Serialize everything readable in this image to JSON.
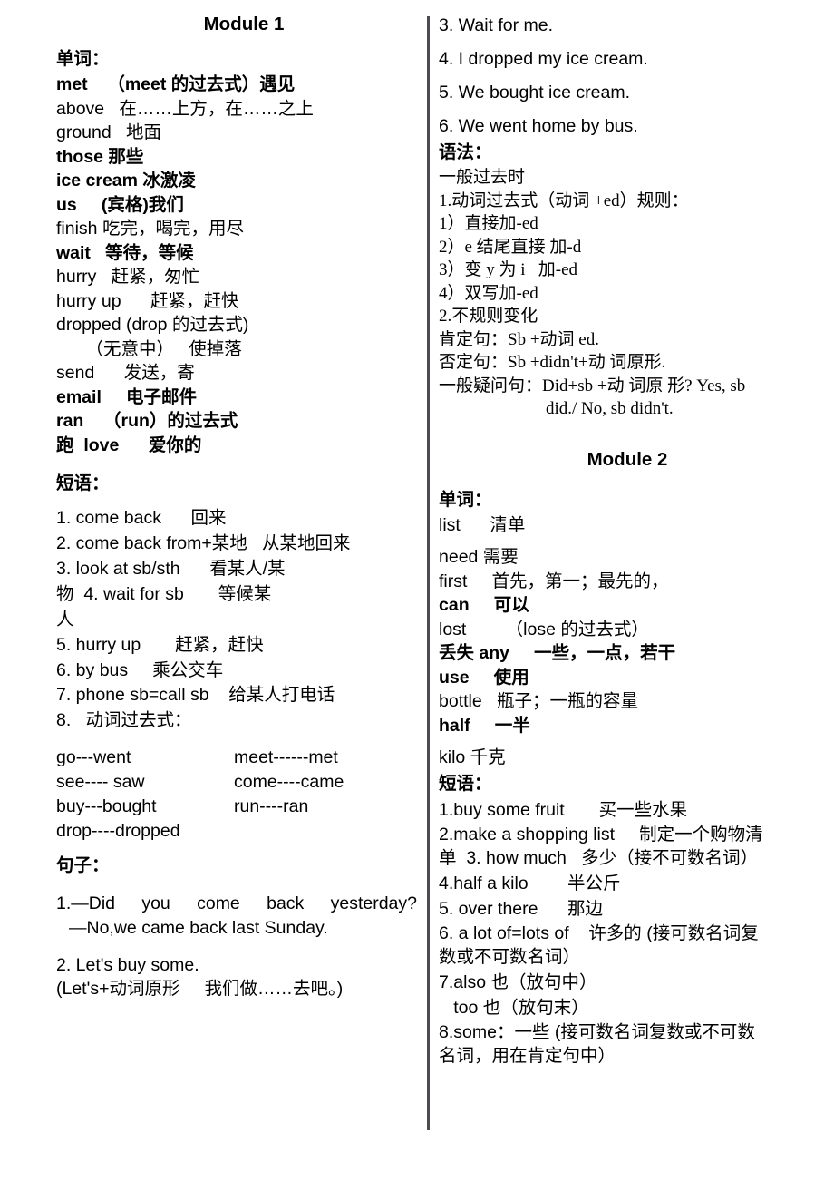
{
  "document": {
    "title": "Module 1 & Module 2 English study notes"
  },
  "left_column": {
    "module_title": "Module 1",
    "words_heading": "单词：",
    "words": [
      {
        "text": "met    （meet 的过去式）遇见",
        "bold": true
      },
      {
        "text": "above   在……上方，在……之上",
        "bold": false
      },
      {
        "text": "ground   地面",
        "bold": false
      },
      {
        "text": "those 那些",
        "bold": true
      },
      {
        "text": "ice cream 冰激凌",
        "bold": true
      },
      {
        "text": "us     (宾格)我们",
        "bold": true
      },
      {
        "text": "finish 吃完，喝完，用尽",
        "bold": false
      },
      {
        "text": "wait   等待，等候",
        "bold": true
      },
      {
        "text": "hurry   赶紧，匆忙",
        "bold": false
      },
      {
        "text": "hurry up      赶紧，赶快",
        "bold": false
      },
      {
        "text": "dropped (drop 的过去式)",
        "bold": false
      },
      {
        "text": "      （无意中）   使掉落",
        "bold": false
      },
      {
        "text": "send      发送，寄",
        "bold": false
      },
      {
        "text": "email     电子邮件",
        "bold": true
      },
      {
        "text": "ran    （run）的过去式",
        "bold": true
      },
      {
        "text": "跑  love      爱你的",
        "bold": true
      }
    ],
    "phrases_heading": "短语：",
    "phrases": [
      "1. come back      回来",
      "2. come back from+某地   从某地回来",
      "3. look at sb/sth      看某人/某",
      "物  4. wait for sb       等候某",
      "人",
      "5. hurry up       赶紧，赶快",
      "6. by bus     乘公交车",
      "7. phone sb=call sb    给某人打电话",
      "8.   动词过去式："
    ],
    "verb_pairs": [
      {
        "left": "go---went",
        "right": "meet------met"
      },
      {
        "left": "see---- saw",
        "right": "come----came"
      },
      {
        "left": "buy---bought",
        "right": "run----ran"
      },
      {
        "left": "drop----dropped",
        "right": ""
      }
    ],
    "sentences_heading": "句子：",
    "sentences": [
      "1.—Did you come back yesterday?",
      "—No,we came back last Sunday.",
      "2. Let's buy some.",
      "(Let's+动词原形     我们做……去吧。)"
    ]
  },
  "right_column": {
    "sentences_continued": [
      "3. Wait for me.",
      "4. I dropped my ice cream.",
      "5. We bought ice cream.",
      "6. We went home by bus."
    ],
    "grammar_heading": "语法：",
    "grammar_lines": [
      "一般过去时",
      "1.动词过去式（动词 +ed）规则：",
      "1）直接加-ed",
      "2）e 结尾直接 加-d",
      "3）变 y 为 i   加-ed",
      "4）双写加-ed",
      "2.不规则变化",
      "肯定句：Sb +动词 ed.",
      "否定句：Sb +didn't+动 词原形.",
      "一般疑问句：Did+sb +动 词原 形? Yes, sb"
    ],
    "grammar_last_line": "did./ No, sb didn't.",
    "module_title": "Module 2",
    "words_heading": "单词：",
    "words": [
      {
        "text": "list      清单",
        "bold": false
      },
      {
        "text": "",
        "bold": false
      },
      {
        "text": "need 需要",
        "bold": false
      },
      {
        "text": "first     首先，第一；最先的，",
        "bold": false
      },
      {
        "text": "can     可以",
        "bold": true
      },
      {
        "text": "lost        （lose 的过去式）",
        "bold": false
      },
      {
        "text": "丢失 any     一些，一点，若干",
        "bold": true
      },
      {
        "text": "use     使用",
        "bold": true
      },
      {
        "text": "bottle   瓶子；一瓶的容量",
        "bold": false
      },
      {
        "text": "half     一半",
        "bold": true
      },
      {
        "text": "",
        "bold": false
      },
      {
        "text": "kilo 千克",
        "bold": false
      }
    ],
    "phrases_heading": "短语：",
    "phrases": [
      "1.buy some fruit       买一些水果",
      "2.make a shopping list     制定一个购物清",
      "单  3. how much   多少（接不可数名词）",
      "4.half a kilo        半公斤",
      "5. over there      那边",
      "6. a lot of=lots of    许多的 (接可数名词复",
      "数或不可数名词）",
      "7.also 也（放句中）",
      "   too 也（放句末）",
      "8.some：一些 (接可数名词复数或不可数",
      "名词，用在肯定句中）"
    ]
  }
}
